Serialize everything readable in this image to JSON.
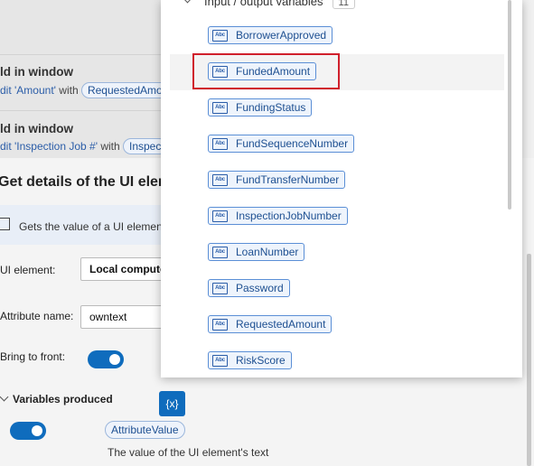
{
  "flow": {
    "step1_title": "ld in window",
    "step1_sub_prefix": "dit 'Amount'",
    "step1_with": " with ",
    "step1_pill": "RequestedAmo",
    "step2_title": "ld in window",
    "step2_sub_prefix": "dit 'Inspection Job #'",
    "step2_with": " with ",
    "step2_pill": "Inspec"
  },
  "dialog": {
    "title": "Get details of the UI elem",
    "info": "Gets the value of a UI element",
    "ui_element_label": "UI element:",
    "ui_element_value": "Local compute",
    "attribute_label": "Attribute name:",
    "attribute_value": "owntext",
    "bring_front_label": "Bring to front:",
    "vars_header": "Variables produced",
    "x_button": "{x}",
    "attribute_var": "AttributeValue",
    "attribute_desc": "The value of the UI element's text"
  },
  "popup": {
    "header": "Input / output variables",
    "count": "11",
    "abc_icon_label": "Abc",
    "variables": [
      "BorrowerApproved",
      "FundedAmount",
      "FundingStatus",
      "FundSequenceNumber",
      "FundTransferNumber",
      "InspectionJobNumber",
      "LoanNumber",
      "Password",
      "RequestedAmount",
      "RiskScore"
    ],
    "highlighted": "FundedAmount"
  },
  "colors": {
    "accent": "#0f6cbd",
    "highlight_border": "#d0202c",
    "chip_border": "#5b8fd6"
  }
}
